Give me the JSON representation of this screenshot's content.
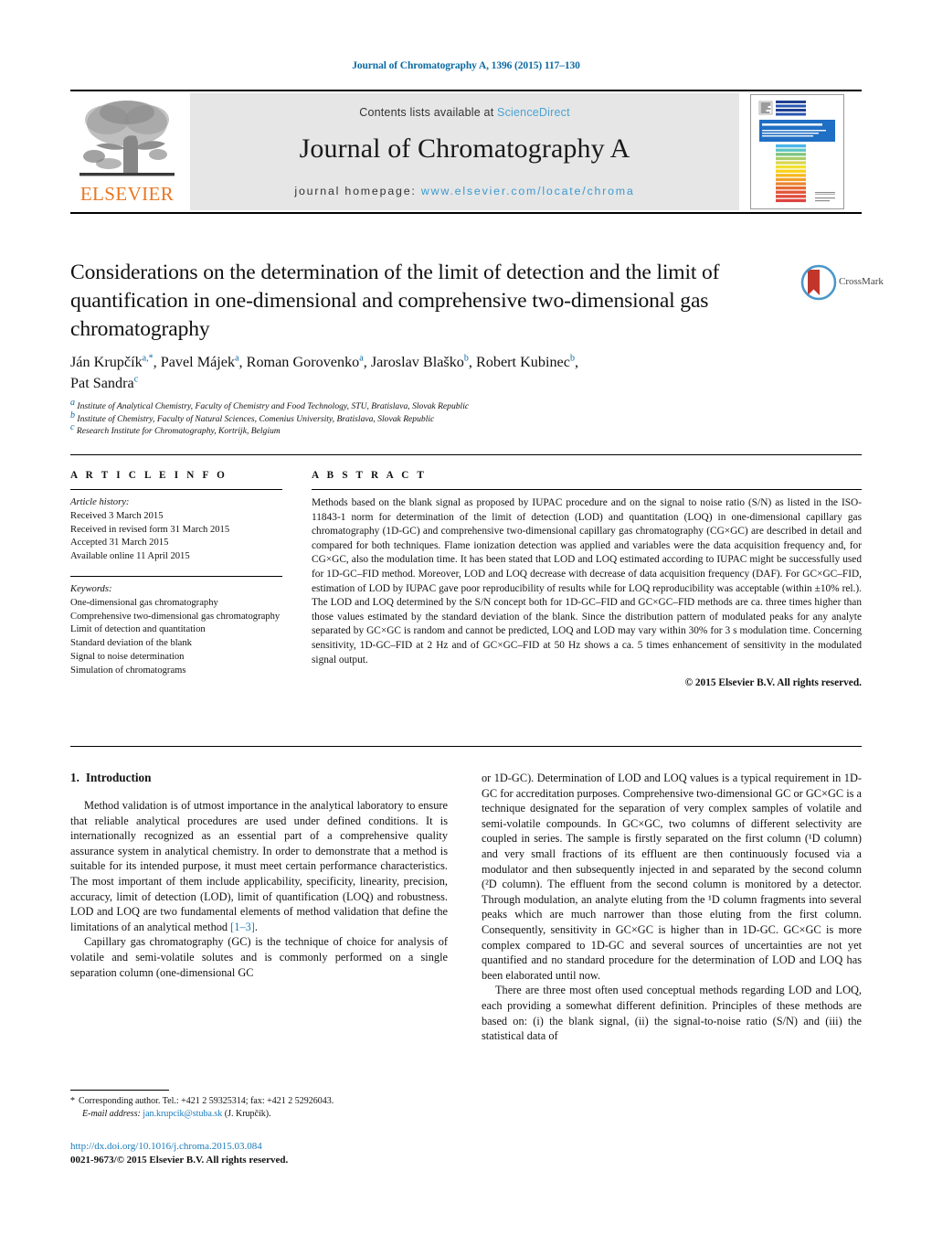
{
  "running_head": "Journal of Chromatography A, 1396 (2015) 117–130",
  "masthead": {
    "contents_prefix": "Contents lists available at ",
    "sciencedirect": "ScienceDirect",
    "journal_name": "Journal of Chromatography A",
    "homepage_prefix": "journal homepage: ",
    "homepage_url": "www.elsevier.com/locate/chroma",
    "publisher": "ELSEVIER",
    "publisher_logo_icon": "elsevier-tree-icon",
    "cover_icon": "journal-cover-thumbnail",
    "cover_title": "JOURNAL OF CHROMATOGRAPHY A"
  },
  "article": {
    "title": "Considerations on the determination of the limit of detection and the limit of quantification in one-dimensional and comprehensive two-dimensional gas chromatography",
    "crossmark_label": "CrossMark",
    "crossmark_icon": "crossmark-logo-icon",
    "authors_line1": "Ján Krupčík",
    "authors_html": "Ján Krupčík<sup>a,*</sup>, Pavel Májek<sup>a</sup>, Roman Gorovenko<sup>a</sup>, Jaroslav Blaško<sup>b</sup>, Robert Kubinec<sup>b</sup>, Pat Sandra<sup>c</sup>",
    "affiliations": [
      {
        "marker": "a",
        "text": "Institute of Analytical Chemistry, Faculty of Chemistry and Food Technology, STU, Bratislava, Slovak Republic"
      },
      {
        "marker": "b",
        "text": "Institute of Chemistry, Faculty of Natural Sciences, Comenius University, Bratislava, Slovak Republic"
      },
      {
        "marker": "c",
        "text": "Research Institute for Chromatography, Kortrijk, Belgium"
      }
    ]
  },
  "article_info": {
    "heading": "A R T I C L E    I N F O",
    "history_label": "Article history:",
    "history": [
      "Received 3 March 2015",
      "Received in revised form 31 March 2015",
      "Accepted 31 March 2015",
      "Available online 11 April 2015"
    ],
    "keywords_label": "Keywords:",
    "keywords": [
      "One-dimensional gas chromatography",
      "Comprehensive two-dimensional gas chromatography",
      "Limit of detection and quantitation",
      "Standard deviation of the blank",
      "Signal to noise determination",
      "Simulation of chromatograms"
    ]
  },
  "abstract": {
    "heading": "A B S T R A C T",
    "text": "Methods based on the blank signal as proposed by IUPAC procedure and on the signal to noise ratio (S/N) as listed in the ISO-11843-1 norm for determination of the limit of detection (LOD) and quantitation (LOQ) in one-dimensional capillary gas chromatography (1D-GC) and comprehensive two-dimensional capillary gas chromatography (CG×GC) are described in detail and compared for both techniques. Flame ionization detection was applied and variables were the data acquisition frequency and, for CG×GC, also the modulation time. It has been stated that LOD and LOQ estimated according to IUPAC might be successfully used for 1D-GC–FID method. Moreover, LOD and LOQ decrease with decrease of data acquisition frequency (DAF). For GC×GC–FID, estimation of LOD by IUPAC gave poor reproducibility of results while for LOQ reproducibility was acceptable (within ±10% rel.). The LOD and LOQ determined by the S/N concept both for 1D-GC–FID and GC×GC–FID methods are ca. three times higher than those values estimated by the standard deviation of the blank. Since the distribution pattern of modulated peaks for any analyte separated by GC×GC is random and cannot be predicted, LOQ and LOD may vary within 30% for 3 s modulation time. Concerning sensitivity, 1D-GC–FID at 2 Hz and of GC×GC–FID at 50 Hz shows a ca. 5 times enhancement of sensitivity in the modulated signal output.",
    "copyright": "© 2015 Elsevier B.V. All rights reserved."
  },
  "body": {
    "section_number": "1.",
    "section_title": "Introduction",
    "left_paragraphs": [
      "Method validation is of utmost importance in the analytical laboratory to ensure that reliable analytical procedures are used under defined conditions. It is internationally recognized as an essential part of a comprehensive quality assurance system in analytical chemistry. In order to demonstrate that a method is suitable for its intended purpose, it must meet certain performance characteristics. The most important of them include applicability, specificity, linearity, precision, accuracy, limit of detection (LOD), limit of quantification (LOQ) and robustness. LOD and LOQ are two fundamental elements of method validation that define the limitations of an analytical method [1–3].",
      "Capillary gas chromatography (GC) is the technique of choice for analysis of volatile and semi-volatile solutes and is commonly performed on a single separation column (one-dimensional GC"
    ],
    "left_paragraph_1_tail_ref": "[1–3]",
    "right_paragraphs": [
      "or 1D-GC). Determination of LOD and LOQ values is a typical requirement in 1D-GC for accreditation purposes. Comprehensive two-dimensional GC or GC×GC is a technique designated for the separation of very complex samples of volatile and semi-volatile compounds. In GC×GC, two columns of different selectivity are coupled in series. The sample is firstly separated on the first column (¹D column) and very small fractions of its effluent are then continuously focused via a modulator and then subsequently injected in and separated by the second column (²D column). The effluent from the second column is monitored by a detector. Through modulation, an analyte eluting from the ¹D column fragments into several peaks which are much narrower than those eluting from the first column. Consequently, sensitivity in GC×GC is higher than in 1D-GC. GC×GC is more complex compared to 1D-GC and several sources of uncertainties are not yet quantified and no standard procedure for the determination of LOD and LOQ has been elaborated until now.",
      "There are three most often used conceptual methods regarding LOD and LOQ, each providing a somewhat different definition. Principles of these methods are based on: (i) the blank signal, (ii) the signal-to-noise ratio (S/N) and (iii) the statistical data of"
    ]
  },
  "footnote": {
    "star": "*",
    "corresponding": "Corresponding author. Tel.: +421 2 59325314; fax: +421 2 52926043.",
    "email_label": "E-mail address:",
    "email": "jan.krupcik@stuba.sk",
    "email_suffix": "(J. Krupčík)."
  },
  "doi": {
    "url": "http://dx.doi.org/10.1016/j.chroma.2015.03.084",
    "issn_line": "0021-9673/© 2015 Elsevier B.V. All rights reserved."
  },
  "colors": {
    "link_blue": "#1a7bb9",
    "header_blue": "#0b6aa2",
    "sciencedirect_blue": "#4ba3d3",
    "elsevier_orange": "#e87722",
    "band_grey": "#e6e6e6"
  }
}
